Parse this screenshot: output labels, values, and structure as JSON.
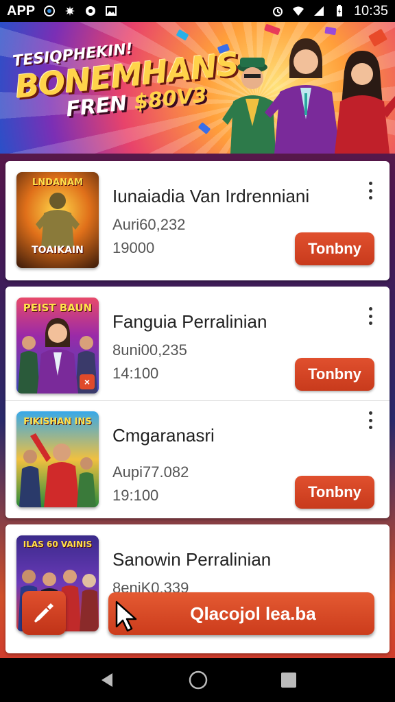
{
  "status_bar": {
    "app_label": "APP",
    "time": "10:35"
  },
  "banner": {
    "line1": "TESIQPHEKIN!",
    "line2": "BONEMHANS",
    "line3_prefix": "FREN ",
    "line3_amount": "$80V3"
  },
  "items": [
    {
      "thumb_title": "LNDANAM",
      "thumb_caption": "TOAIKAIN",
      "title": "Iunaiadia Van Irdrenniani",
      "sub": "Auri60,232",
      "num": "19000",
      "button": "Tonbny"
    },
    {
      "thumb_title": "PEIST BAUN",
      "title": "Fanguia Perralinian",
      "sub": "8uni00,235",
      "num": "14:100",
      "button": "Tonbny"
    },
    {
      "thumb_title": "FIKISHAN INS",
      "title": "Cmgaranasri",
      "sub": "Aupi77.082",
      "num": "19:100",
      "button": "Tonbny"
    },
    {
      "thumb_title": "ILAS 60 VAINIS",
      "title": "Sanowin Perralinian",
      "sub": "8eniK0.339"
    }
  ],
  "cta": {
    "label": "Qlacojol lea.ba"
  },
  "colors": {
    "accent": "#d9472a",
    "card": "#ffffff"
  },
  "icons": [
    "wifi-icon",
    "signal-icon",
    "battery-icon",
    "more-vert-icon",
    "tool-icon",
    "cursor-icon",
    "back-icon",
    "home-icon",
    "recents-icon"
  ]
}
